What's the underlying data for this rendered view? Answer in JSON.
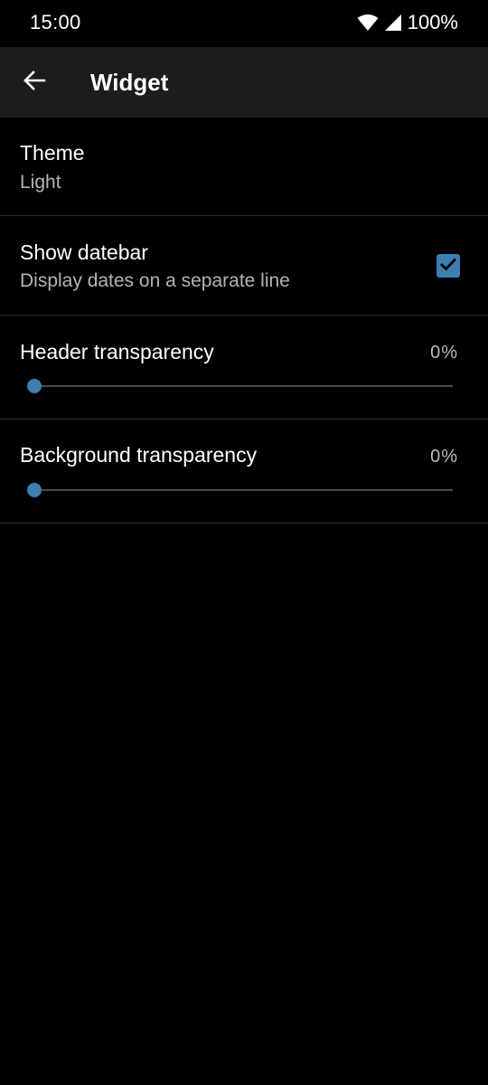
{
  "status_bar": {
    "time": "15:00",
    "battery": "100%",
    "icons": [
      "wifi-icon",
      "cell-signal-icon"
    ]
  },
  "app_bar": {
    "back_icon": "arrow-left-icon",
    "title": "Widget"
  },
  "preferences": {
    "theme": {
      "title": "Theme",
      "summary": "Light"
    },
    "show_datebar": {
      "title": "Show datebar",
      "summary": "Display dates on a separate line",
      "checked": true
    },
    "header_transparency": {
      "title": "Header transparency",
      "value_label": "0%",
      "value": 0
    },
    "background_transparency": {
      "title": "Background transparency",
      "value_label": "0%",
      "value": 0
    }
  },
  "colors": {
    "accent": "#3d7eb0",
    "background": "#000000",
    "app_bar": "#1c1c1c"
  }
}
